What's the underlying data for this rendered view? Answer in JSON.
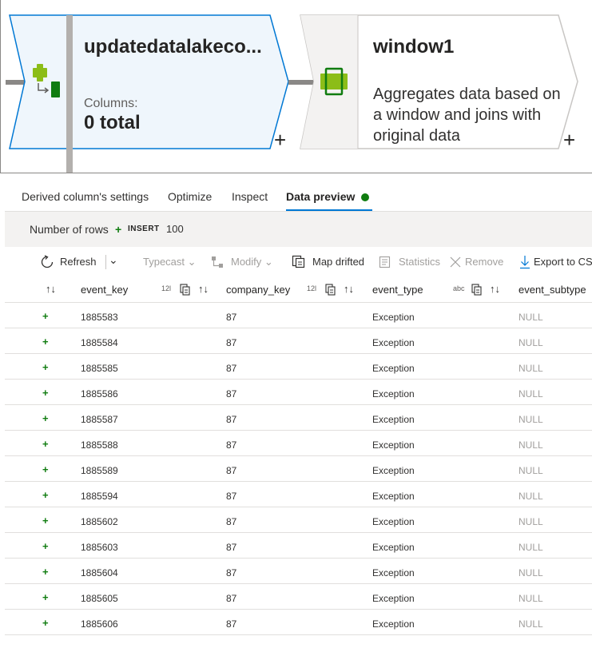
{
  "nodes": [
    {
      "title": "updatedatalakeco...",
      "sub_label": "Columns:",
      "total": "0 total"
    },
    {
      "title": "window1",
      "description": "Aggregates data based on a window and joins with original data"
    }
  ],
  "add_label": "+",
  "tabs": [
    {
      "label": "Derived column's settings"
    },
    {
      "label": "Optimize"
    },
    {
      "label": "Inspect"
    },
    {
      "label": "Data preview"
    }
  ],
  "rows_bar": {
    "label": "Number of rows",
    "insert_label": "INSERT",
    "count": "100"
  },
  "toolbar": {
    "refresh": "Refresh",
    "typecast": "Typecast",
    "modify": "Modify",
    "map_drifted": "Map drifted",
    "statistics": "Statistics",
    "remove": "Remove",
    "export": "Export to CSV"
  },
  "columns": [
    {
      "name": "event_key",
      "type": ""
    },
    {
      "name": "company_key",
      "type": "12l"
    },
    {
      "name": "event_type",
      "type": "12l"
    },
    {
      "name": "event_subtype",
      "type": "abc"
    }
  ],
  "rows": [
    [
      "1885583",
      "87",
      "Exception",
      "NULL"
    ],
    [
      "1885584",
      "87",
      "Exception",
      "NULL"
    ],
    [
      "1885585",
      "87",
      "Exception",
      "NULL"
    ],
    [
      "1885586",
      "87",
      "Exception",
      "NULL"
    ],
    [
      "1885587",
      "87",
      "Exception",
      "NULL"
    ],
    [
      "1885588",
      "87",
      "Exception",
      "NULL"
    ],
    [
      "1885589",
      "87",
      "Exception",
      "NULL"
    ],
    [
      "1885594",
      "87",
      "Exception",
      "NULL"
    ],
    [
      "1885602",
      "87",
      "Exception",
      "NULL"
    ],
    [
      "1885603",
      "87",
      "Exception",
      "NULL"
    ],
    [
      "1885604",
      "87",
      "Exception",
      "NULL"
    ],
    [
      "1885605",
      "87",
      "Exception",
      "NULL"
    ],
    [
      "1885606",
      "87",
      "Exception",
      "NULL"
    ]
  ],
  "colors": {
    "accent": "#0078d4",
    "insert_green": "#107c10",
    "node_selected_bg": "#eff6fc",
    "null_gray": "#a19f9d"
  }
}
